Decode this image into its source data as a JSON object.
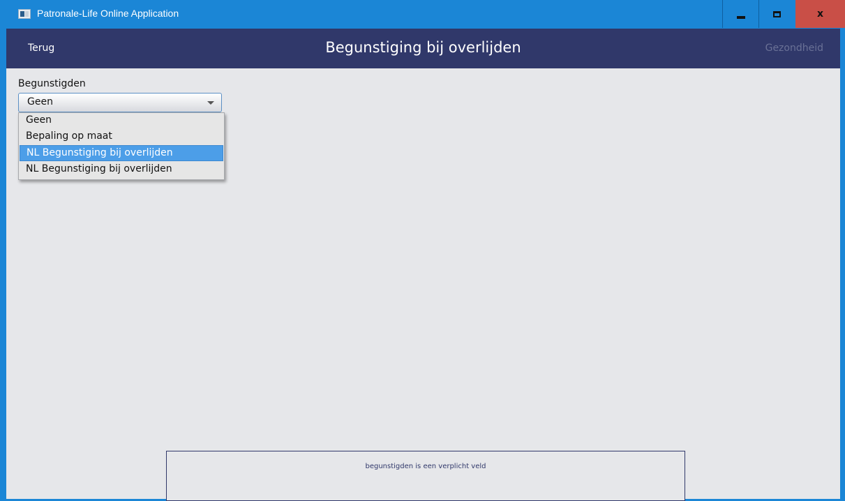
{
  "window": {
    "title": "Patronale-Life Online Application",
    "minimize_icon": "minimize-icon",
    "maximize_icon": "maximize-icon",
    "close_label": "x"
  },
  "nav": {
    "back_label": "Terug",
    "title": "Begunstiging bij overlijden",
    "next_label": "Gezondheid"
  },
  "form": {
    "beneficiaries_label": "Begunstigden",
    "selected_value": "Geen",
    "options": [
      "Geen",
      "Bepaling op maat",
      "NL Begunstiging bij overlijden",
      "NL Begunstiging bij overlijden"
    ],
    "highlighted_index": 2
  },
  "validation": {
    "message": "begunstigden is een verplicht veld"
  },
  "colors": {
    "titlebar": "#1b86d6",
    "header": "#30386a",
    "content_bg": "#e6e7ea",
    "highlight": "#4c9ee8",
    "close_button": "#c94f47"
  }
}
